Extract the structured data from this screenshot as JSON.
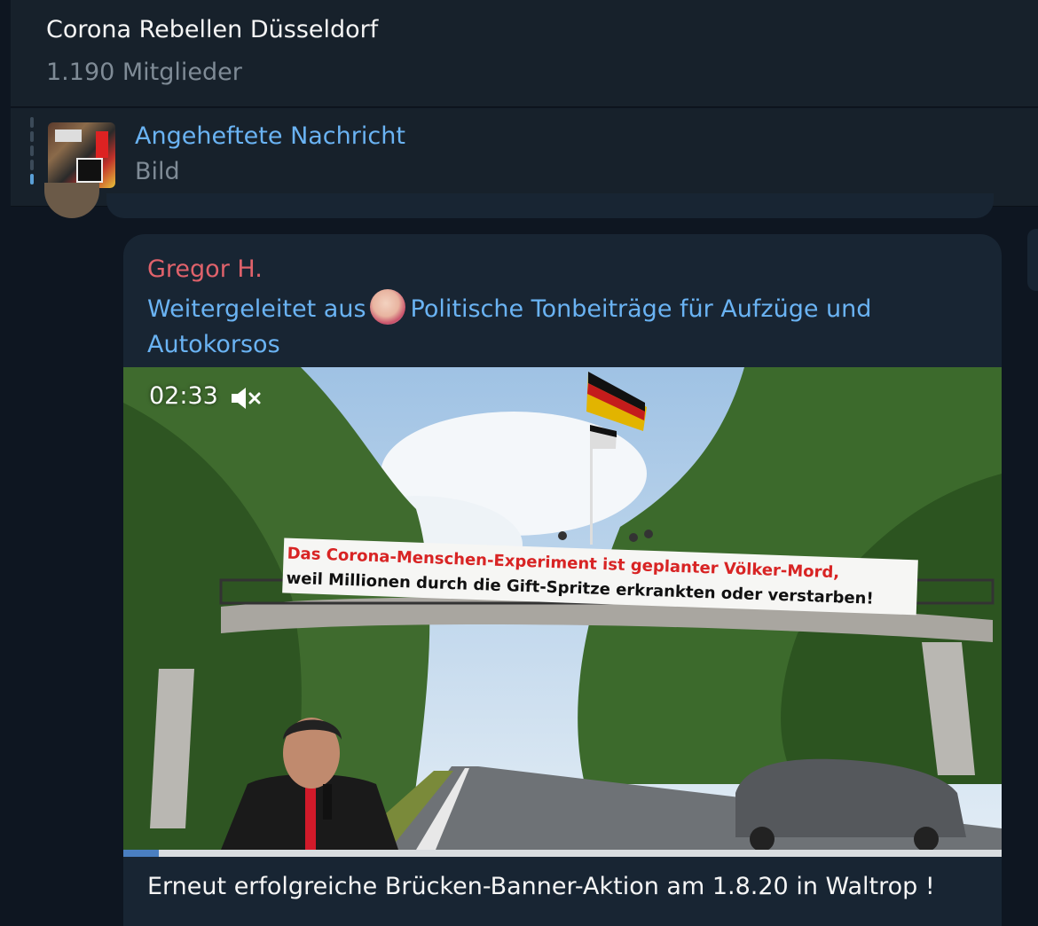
{
  "header": {
    "title": "Corona Rebellen Düsseldorf",
    "subtitle": "1.190 Mitglieder"
  },
  "pinned": {
    "title": "Angeheftete Nachricht",
    "text": "Bild"
  },
  "message": {
    "sender": "Gregor H.",
    "forward_prefix": "Weitergeleitet aus",
    "forward_source": "Politische Tonbeiträge für Aufzüge und Autokorsos",
    "video": {
      "duration": "02:33",
      "muted": true,
      "banner_line1": "Das Corona-Menschen-Experiment ist geplanter Völker-Mord,",
      "banner_line2": "weil Millionen durch die Gift-Spritze erkrankten oder verstarben!",
      "progress": 0.04
    },
    "caption": "Erneut erfolgreiche Brücken-Banner-Aktion am 1.8.20 in Waltrop !"
  },
  "colors": {
    "background": "#0e1621",
    "panel": "#17212b",
    "bubble": "#182533",
    "link": "#6ab3f3",
    "sender": "#e0626b",
    "muted_text": "#7f8b96"
  },
  "icons": [
    "pinned-thumbnail",
    "speaker-muted-icon",
    "channel-avatar"
  ]
}
